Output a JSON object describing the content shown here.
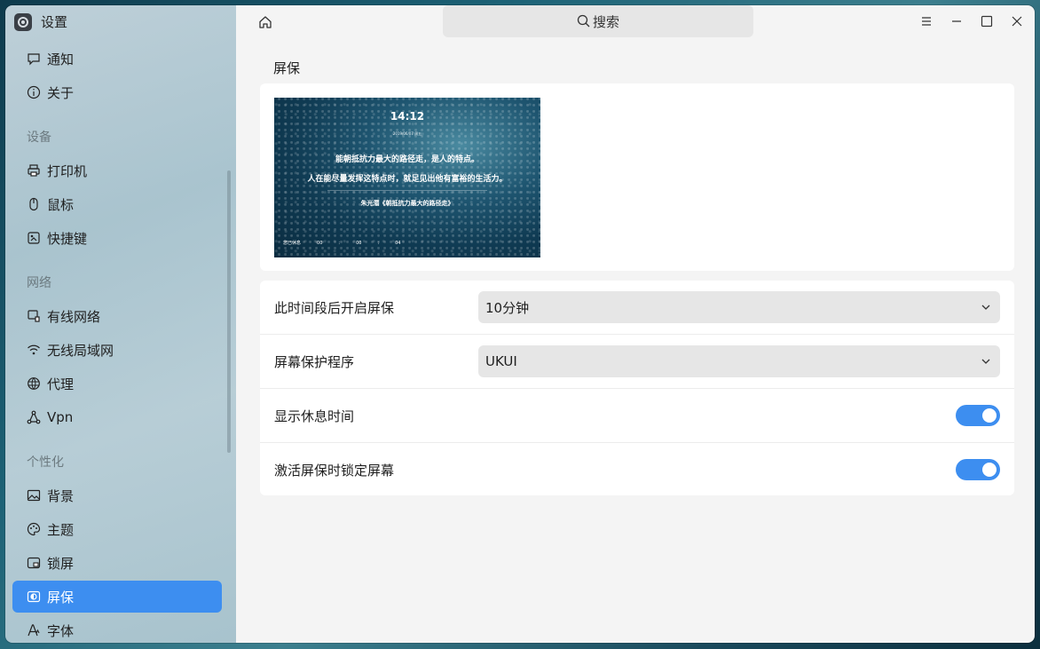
{
  "app": {
    "title": "设置"
  },
  "sidebar": {
    "items_top": [
      {
        "label": "通知",
        "icon": "chat-bubble-icon"
      },
      {
        "label": "关于",
        "icon": "info-icon"
      }
    ],
    "groups": [
      {
        "title": "设备",
        "items": [
          {
            "label": "打印机",
            "icon": "printer-icon"
          },
          {
            "label": "鼠标",
            "icon": "mouse-icon"
          },
          {
            "label": "快捷键",
            "icon": "keyboard-shortcut-icon"
          }
        ]
      },
      {
        "title": "网络",
        "items": [
          {
            "label": "有线网络",
            "icon": "wired-network-icon"
          },
          {
            "label": "无线局域网",
            "icon": "wifi-icon"
          },
          {
            "label": "代理",
            "icon": "proxy-globe-icon"
          },
          {
            "label": "Vpn",
            "icon": "vpn-icon"
          }
        ]
      },
      {
        "title": "个性化",
        "items": [
          {
            "label": "背景",
            "icon": "wallpaper-icon"
          },
          {
            "label": "主题",
            "icon": "palette-icon"
          },
          {
            "label": "锁屏",
            "icon": "lock-screen-icon"
          },
          {
            "label": "屏保",
            "icon": "screensaver-icon",
            "active": true
          },
          {
            "label": "字体",
            "icon": "font-icon"
          }
        ]
      }
    ]
  },
  "search": {
    "placeholder": "搜索"
  },
  "main": {
    "section_title": "屏保",
    "preview": {
      "time": "14:12",
      "date": "2019/06/07 周五",
      "quote_line1": "能朝抵抗力最大的路径走，是人的特点。",
      "quote_line2": "人在能尽量发挥这特点时，就足见出他有富裕的生活力。",
      "author": "朱光潜《朝抵抗力最大的路径走》",
      "rest_label": "您已休息",
      "rest_h": "00",
      "rest_m": "00",
      "rest_s": "04"
    },
    "settings": {
      "idle_label": "此时间段后开启屏保",
      "idle_value": "10分钟",
      "program_label": "屏幕保护程序",
      "program_value": "UKUI",
      "show_rest_label": "显示休息时间",
      "show_rest_on": true,
      "lock_label": "激活屏保时锁定屏幕",
      "lock_on": true
    }
  },
  "colors": {
    "accent": "#3d8ef0"
  }
}
